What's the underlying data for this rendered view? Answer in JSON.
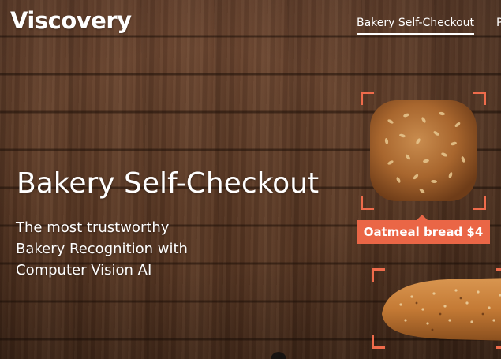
{
  "brand": {
    "logo_text": "Viscovery"
  },
  "nav": {
    "items": [
      {
        "label": "Bakery Self-Checkout",
        "active": true
      },
      {
        "label": "P",
        "active": false
      }
    ]
  },
  "hero": {
    "title": "Bakery Self-Checkout",
    "subtitle": "The most trustworthy Bakery Recognition with Computer Vision AI"
  },
  "detections": [
    {
      "label": "Oatmeal bread $4",
      "item_icon": "oatmeal-bread-image"
    },
    {
      "label": "",
      "item_icon": "baguette-image"
    }
  ],
  "colors": {
    "accent": "#ea6646",
    "text": "#ffffff",
    "wood": "#5e3c28"
  }
}
